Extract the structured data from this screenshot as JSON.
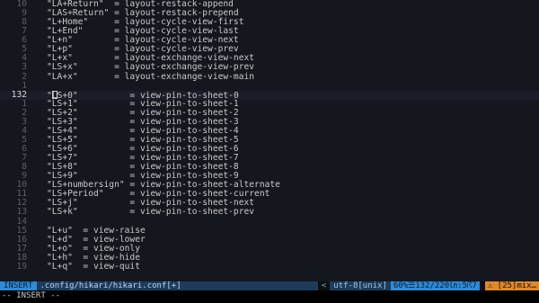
{
  "editor": {
    "lines": [
      {
        "num": "10",
        "text": "\"LA+Return\"  = layout-restack-append"
      },
      {
        "num": "9",
        "text": "\"LAS+Return\" = layout-restack-prepend"
      },
      {
        "num": "8",
        "text": "\"L+Home\"     = layout-cycle-view-first"
      },
      {
        "num": "7",
        "text": "\"L+End\"      = layout-cycle-view-last"
      },
      {
        "num": "6",
        "text": "\"L+n\"        = layout-cycle-view-next"
      },
      {
        "num": "5",
        "text": "\"L+p\"        = layout-cycle-view-prev"
      },
      {
        "num": "4",
        "text": "\"L+x\"        = layout-exchange-view-next"
      },
      {
        "num": "3",
        "text": "\"LS+x\"       = layout-exchange-view-prev"
      },
      {
        "num": "2",
        "text": "\"LA+x\"       = layout-exchange-view-main"
      },
      {
        "num": "1",
        "text": ""
      },
      {
        "num": "132",
        "text": "\"LS+0\"          = view-pin-to-sheet-0",
        "current": true
      },
      {
        "num": "1",
        "text": "\"LS+1\"          = view-pin-to-sheet-1"
      },
      {
        "num": "2",
        "text": "\"LS+2\"          = view-pin-to-sheet-2"
      },
      {
        "num": "3",
        "text": "\"LS+3\"          = view-pin-to-sheet-3"
      },
      {
        "num": "4",
        "text": "\"LS+4\"          = view-pin-to-sheet-4"
      },
      {
        "num": "5",
        "text": "\"LS+5\"          = view-pin-to-sheet-5"
      },
      {
        "num": "6",
        "text": "\"LS+6\"          = view-pin-to-sheet-6"
      },
      {
        "num": "7",
        "text": "\"LS+7\"          = view-pin-to-sheet-7"
      },
      {
        "num": "8",
        "text": "\"LS+8\"          = view-pin-to-sheet-8"
      },
      {
        "num": "9",
        "text": "\"LS+9\"          = view-pin-to-sheet-9"
      },
      {
        "num": "10",
        "text": "\"LS+numbersign\" = view-pin-to-sheet-alternate"
      },
      {
        "num": "11",
        "text": "\"LS+Period\"     = view-pin-to-sheet-current"
      },
      {
        "num": "12",
        "text": "\"LS+j\"          = view-pin-to-sheet-next"
      },
      {
        "num": "13",
        "text": "\"LS+k\"          = view-pin-to-sheet-prev"
      },
      {
        "num": "14",
        "text": ""
      },
      {
        "num": "15",
        "text": "\"L+u\"  = view-raise"
      },
      {
        "num": "16",
        "text": "\"L+d\"  = view-lower"
      },
      {
        "num": "17",
        "text": "\"L+o\"  = view-only"
      },
      {
        "num": "18",
        "text": "\"L+h\"  = view-hide"
      },
      {
        "num": "19",
        "text": "\"L+q\"  = view-quit"
      }
    ]
  },
  "statusbar": {
    "mode": "INSERT",
    "file": ".config/hikari/hikari.conf[+]",
    "separator": "<",
    "encoding": "utf-8[unix]",
    "position": "60%☰132/220㏑:5☈7",
    "warning": "⚠ [25]mix…"
  },
  "cmdline": {
    "text": "-- INSERT --"
  },
  "colors": {
    "editor_bg": "#15171f",
    "line_number": "#5c5f6b",
    "mode_accent": "#2d8bd8",
    "file_segment": "#1e3c5a",
    "warning": "#e0892a"
  }
}
